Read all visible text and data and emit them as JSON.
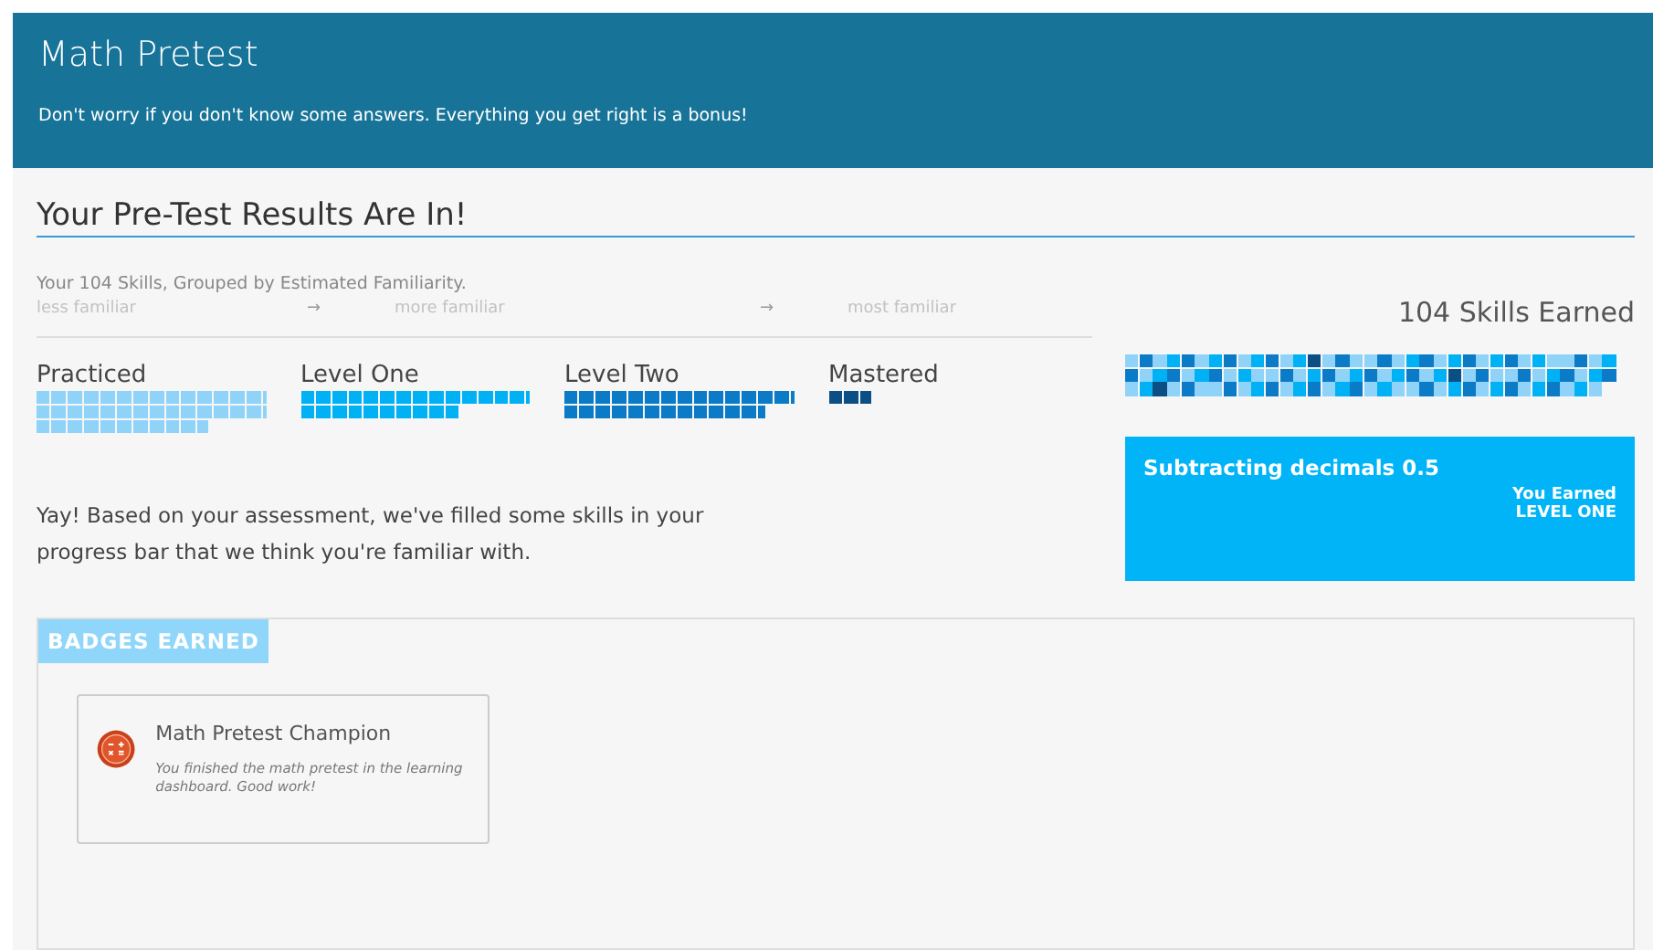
{
  "header": {
    "title": "Math Pretest",
    "subtitle": "Don't worry if you don't know some answers. Everything you get right is a bonus!"
  },
  "results": {
    "heading": "Your Pre-Test Results Are In!",
    "caption": "Your 104 Skills, Grouped by Estimated Familiarity.",
    "scale": [
      {
        "label": "less familiar",
        "arrow": "→"
      },
      {
        "label": "more familiar",
        "arrow": "→"
      },
      {
        "label": "most familiar"
      }
    ],
    "groups": [
      {
        "label": "Practiced",
        "color": "#8fd3f9"
      },
      {
        "label": "Level One",
        "color": "#00b2f5"
      },
      {
        "label": "Level Two",
        "color": "#0b7bc8"
      },
      {
        "label": "Mastered",
        "color": "#0c4f85"
      }
    ],
    "message": "Yay! Based on your assessment, we've filled some skills in your progress bar that we think you're familiar with.",
    "skills_earned": "104 Skills Earned",
    "card": {
      "skill": "Subtracting decimals 0.5",
      "earned_label": "You Earned",
      "earned_level": "LEVEL ONE"
    }
  },
  "badges": {
    "title": "BADGES EARNED",
    "items": [
      {
        "name": "Math Pretest Champion",
        "description": "You finished the math pretest in the learning dashboard. Good work!"
      }
    ]
  }
}
